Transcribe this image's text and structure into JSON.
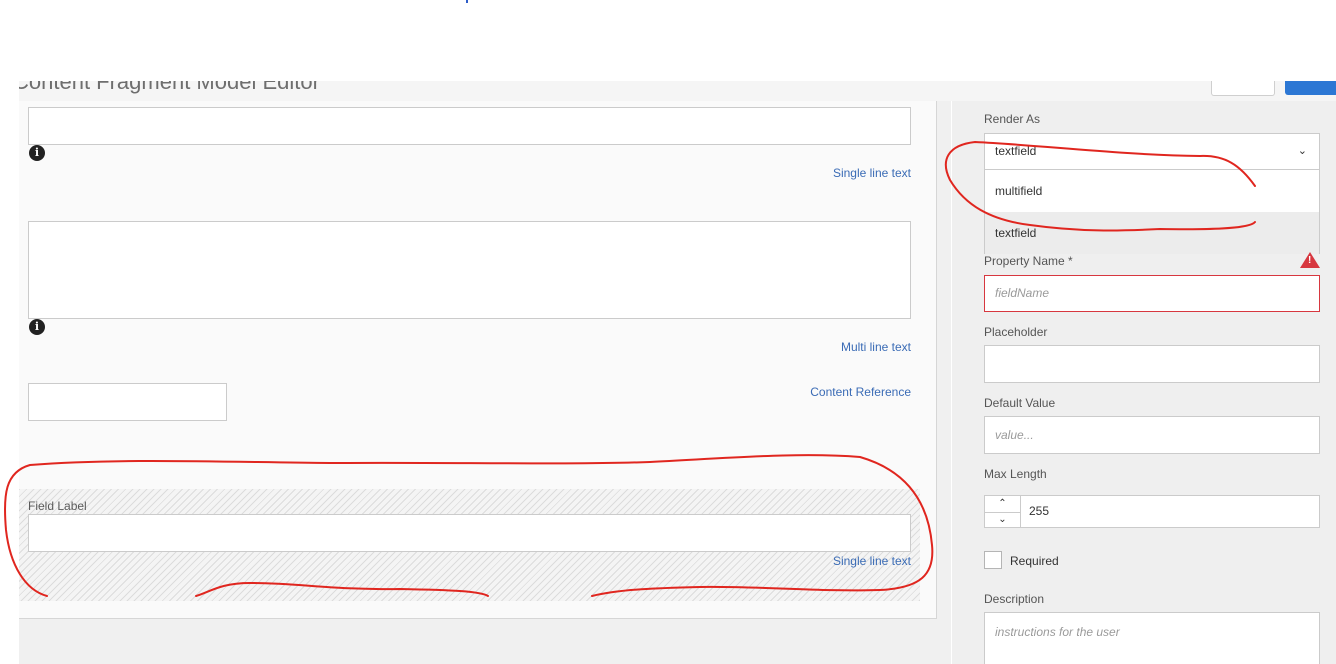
{
  "header": {
    "title": "Content Fragment Model Editor"
  },
  "canvas": {
    "fields": [
      {
        "type_label": "Single line text",
        "info_icon": "info-icon"
      },
      {
        "type_label": "Multi line text",
        "info_icon": "info-icon"
      },
      {
        "type_label": "Content Reference"
      }
    ],
    "drop_zone": {
      "label": "Field Label",
      "type_label": "Single line text"
    }
  },
  "panel": {
    "render_as": {
      "label": "Render As",
      "selected": "textfield",
      "options": [
        "multifield",
        "textfield"
      ]
    },
    "property_name": {
      "label": "Property Name *",
      "placeholder": "fieldName"
    },
    "placeholder_field": {
      "label": "Placeholder"
    },
    "default_value": {
      "label": "Default Value",
      "placeholder": "value..."
    },
    "max_length": {
      "label": "Max Length",
      "value": "255"
    },
    "required": {
      "label": "Required"
    },
    "description": {
      "label": "Description",
      "placeholder": "instructions for the user"
    }
  },
  "colors": {
    "accent_blue": "#2c77d4",
    "link_blue": "#3a6bb5",
    "error_red": "#d7373f",
    "annotation_red": "#e0261f"
  }
}
